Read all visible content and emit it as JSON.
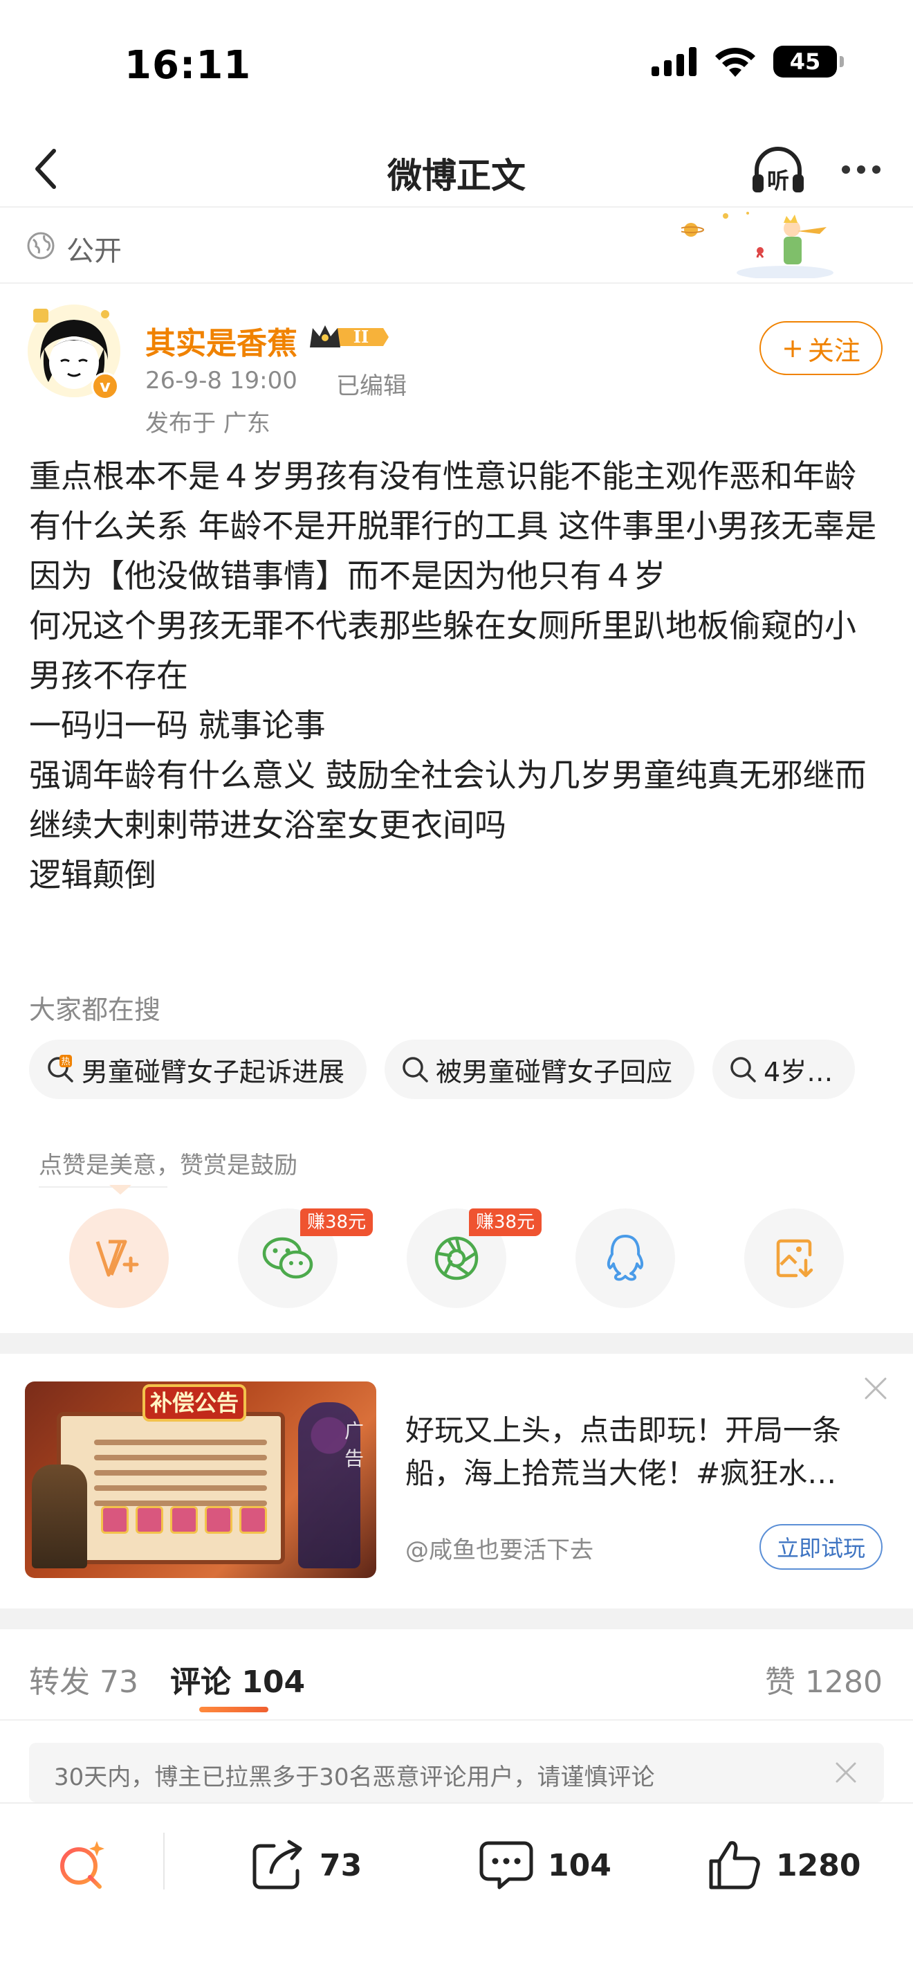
{
  "status_bar": {
    "time": "16:11",
    "battery": "45"
  },
  "nav": {
    "title": "微博正文",
    "listen_label": "听"
  },
  "visibility": {
    "label": "公开"
  },
  "author": {
    "name": "其实是香蕉",
    "badge_level": "II",
    "time": "26-9-8 19:00",
    "edited": "已编辑",
    "location": "发布于 广东",
    "follow_label": "关注",
    "follow_prefix": "+"
  },
  "post": {
    "lines": [
      "重点根本不是４岁男孩有没有性意识能不能主观作恶和年龄有什么关系 年龄不是开脱罪行的工具 这件事里小男孩无辜是因为【他没做错事情】而不是因为他只有４岁",
      "何况这个男孩无罪不代表那些躲在女厕所里趴地板偷窥的小男孩不存在",
      "一码归一码 就事论事",
      "强调年龄有什么意义 鼓励全社会认为几岁男童纯真无邪继而继续大剌剌带进女浴室女更衣间吗",
      "逻辑颠倒"
    ]
  },
  "search": {
    "title": "大家都在搜",
    "chips": [
      {
        "label": "男童碰臂女子起诉进展",
        "hot": true
      },
      {
        "label": "被男童碰臂女子回应",
        "hot": false
      },
      {
        "label": "4岁…",
        "hot": false
      }
    ]
  },
  "reward": {
    "tip": "点赞是美意，赞赏是鼓励",
    "earn_wechat": "赚38元",
    "earn_moments": "赚38元"
  },
  "ad": {
    "tag": "广告",
    "banner": "补偿公告",
    "title": "好玩又上头，点击即玩！开局一条船，海上拾荒当大佬！#疯狂水…",
    "source": "@咸鱼也要活下去",
    "cta": "立即试玩"
  },
  "tabs": {
    "repost": {
      "label": "转发",
      "count": "73"
    },
    "comment": {
      "label": "评论",
      "count": "104"
    },
    "like": {
      "label": "赞",
      "count": "1280"
    }
  },
  "notice": {
    "text": "30天内，博主已拉黑多于30名恶意评论用户，请谨慎评论"
  },
  "bottom_bar": {
    "repost_count": "73",
    "comment_count": "104",
    "like_count": "1280"
  },
  "colors": {
    "accent": "#f08200",
    "link_blue": "#3e74c2",
    "badge_red": "#ef5330"
  },
  "icons": [
    "back-icon",
    "listen-icon",
    "more-icon",
    "globe-icon",
    "verified-icon",
    "crown-icon",
    "search-icon",
    "hot-search-icon",
    "v-plus-icon",
    "wechat-icon",
    "moments-icon",
    "qq-icon",
    "save-image-icon",
    "close-icon",
    "ai-search-icon",
    "repost-icon",
    "comment-icon",
    "like-icon"
  ]
}
